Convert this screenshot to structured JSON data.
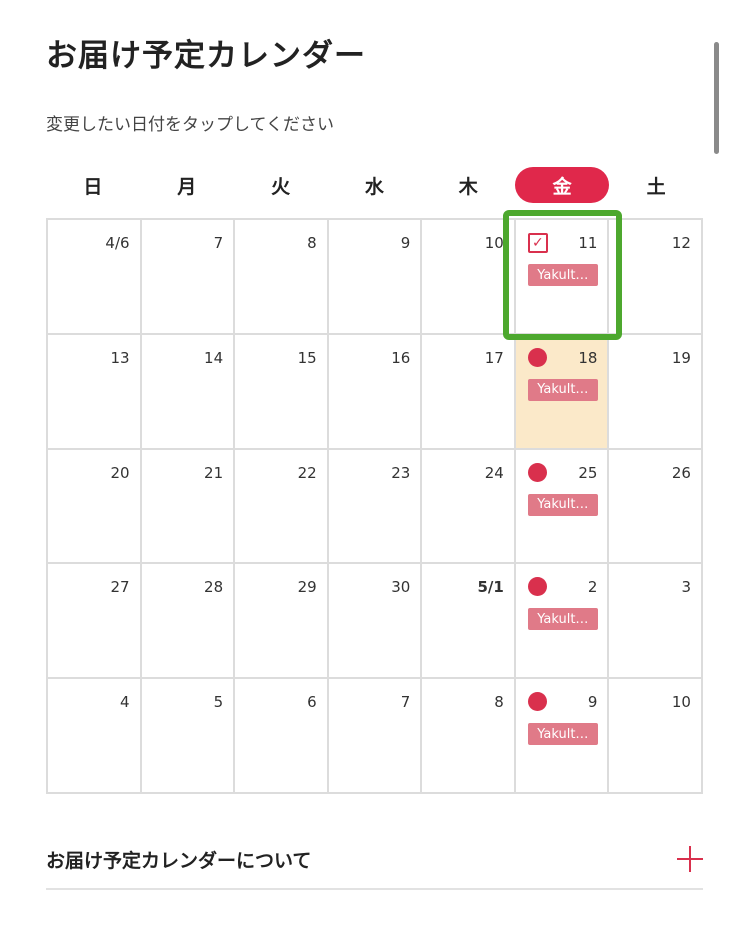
{
  "header": {
    "title": "お届け予定カレンダー",
    "subtitle": "変更したい日付をタップしてください"
  },
  "calendar": {
    "weekdays": [
      "日",
      "月",
      "火",
      "水",
      "木",
      "金",
      "土"
    ],
    "active_weekday_index": 5,
    "delivery_tag": "Yakult…",
    "rows": [
      [
        {
          "label": "4/6"
        },
        {
          "label": "7"
        },
        {
          "label": "8"
        },
        {
          "label": "9"
        },
        {
          "label": "10"
        },
        {
          "label": "11",
          "marker": "check",
          "tag": true,
          "selected": true
        },
        {
          "label": "12"
        }
      ],
      [
        {
          "label": "13"
        },
        {
          "label": "14"
        },
        {
          "label": "15"
        },
        {
          "label": "16"
        },
        {
          "label": "17"
        },
        {
          "label": "18",
          "marker": "dot",
          "tag": true,
          "highlight": true
        },
        {
          "label": "19"
        }
      ],
      [
        {
          "label": "20"
        },
        {
          "label": "21"
        },
        {
          "label": "22"
        },
        {
          "label": "23"
        },
        {
          "label": "24"
        },
        {
          "label": "25",
          "marker": "dot",
          "tag": true
        },
        {
          "label": "26"
        }
      ],
      [
        {
          "label": "27"
        },
        {
          "label": "28"
        },
        {
          "label": "29"
        },
        {
          "label": "30"
        },
        {
          "label": "5/1",
          "bold": true
        },
        {
          "label": "2",
          "marker": "dot",
          "tag": true
        },
        {
          "label": "3"
        }
      ],
      [
        {
          "label": "4"
        },
        {
          "label": "5"
        },
        {
          "label": "6"
        },
        {
          "label": "7"
        },
        {
          "label": "8"
        },
        {
          "label": "9",
          "marker": "dot",
          "tag": true
        },
        {
          "label": "10"
        }
      ]
    ]
  },
  "footer": {
    "about_label": "お届け予定カレンダーについて",
    "expand_icon": "plus-icon"
  },
  "colors": {
    "accent": "#e0284b",
    "tag_bg": "#e07a88",
    "highlight_bg": "#fbe9c9",
    "selection_outline": "#4da82e"
  }
}
